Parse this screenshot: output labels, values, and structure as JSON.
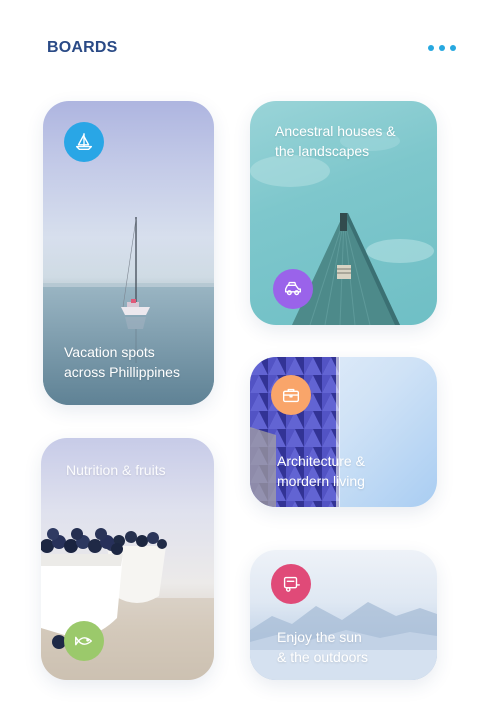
{
  "header": {
    "title": "BOARDS",
    "more_icon": "more-dots-icon",
    "accent": "#27a8e0",
    "title_color": "#2a4a86"
  },
  "boards": [
    {
      "title": "Vacation spots\nacross Phillippines",
      "icon": "sailboat-icon",
      "badge_color": "#29a6e6"
    },
    {
      "title": "Ancestral houses &\nthe landscapes",
      "icon": "car-icon",
      "badge_color": "#9a63ea"
    },
    {
      "title": "Architecture &\nmordern living",
      "icon": "briefcase-icon",
      "badge_color": "#f9a56a"
    },
    {
      "title": "Nutrition & fruits",
      "icon": "fish-icon",
      "badge_color": "#9bc96b"
    },
    {
      "title": "Enjoy the sun\n& the outdoors",
      "icon": "caravan-icon",
      "badge_color": "#e04a78"
    }
  ]
}
